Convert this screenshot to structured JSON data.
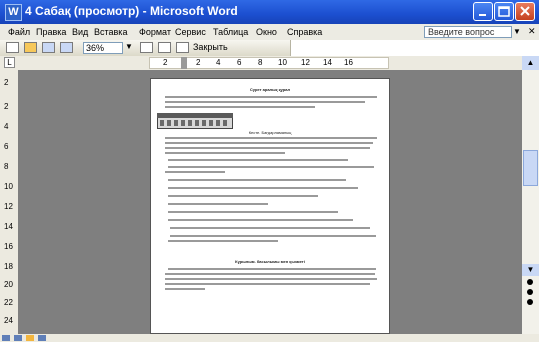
{
  "window": {
    "title": "4 Сабақ (просмотр) - Microsoft Word",
    "app_icon": "W"
  },
  "menu": {
    "items": [
      "Файл",
      "Правка",
      "Вид",
      "Вставка",
      "Формат",
      "Сервис",
      "Таблица",
      "Окно",
      "Справка"
    ],
    "help_placeholder": "Введите вопрос"
  },
  "toolbar": {
    "zoom": "36%",
    "close_label": "Закрыть"
  },
  "ruler": {
    "marks": [
      "2",
      "2",
      "4",
      "6",
      "8",
      "10",
      "12",
      "14",
      "16"
    ]
  },
  "vruler": {
    "marks": [
      "2",
      "2",
      "4",
      "6",
      "8",
      "10",
      "12",
      "14",
      "16",
      "18",
      "20",
      "22",
      "24"
    ]
  },
  "document": {
    "heading1": "Сурет аралық құрал",
    "caption": "Кесте. Бағдарламаның",
    "heading2": "Кұрылым. басылымы мен қызметі"
  },
  "colors": {
    "titlebar": "#1c4fd0",
    "menubar": "#ecebe3",
    "workspace": "#7f7f7f"
  },
  "icons": {
    "app": "word-icon",
    "minimize": "minimize-icon",
    "maximize": "maximize-icon",
    "close": "close-icon"
  }
}
